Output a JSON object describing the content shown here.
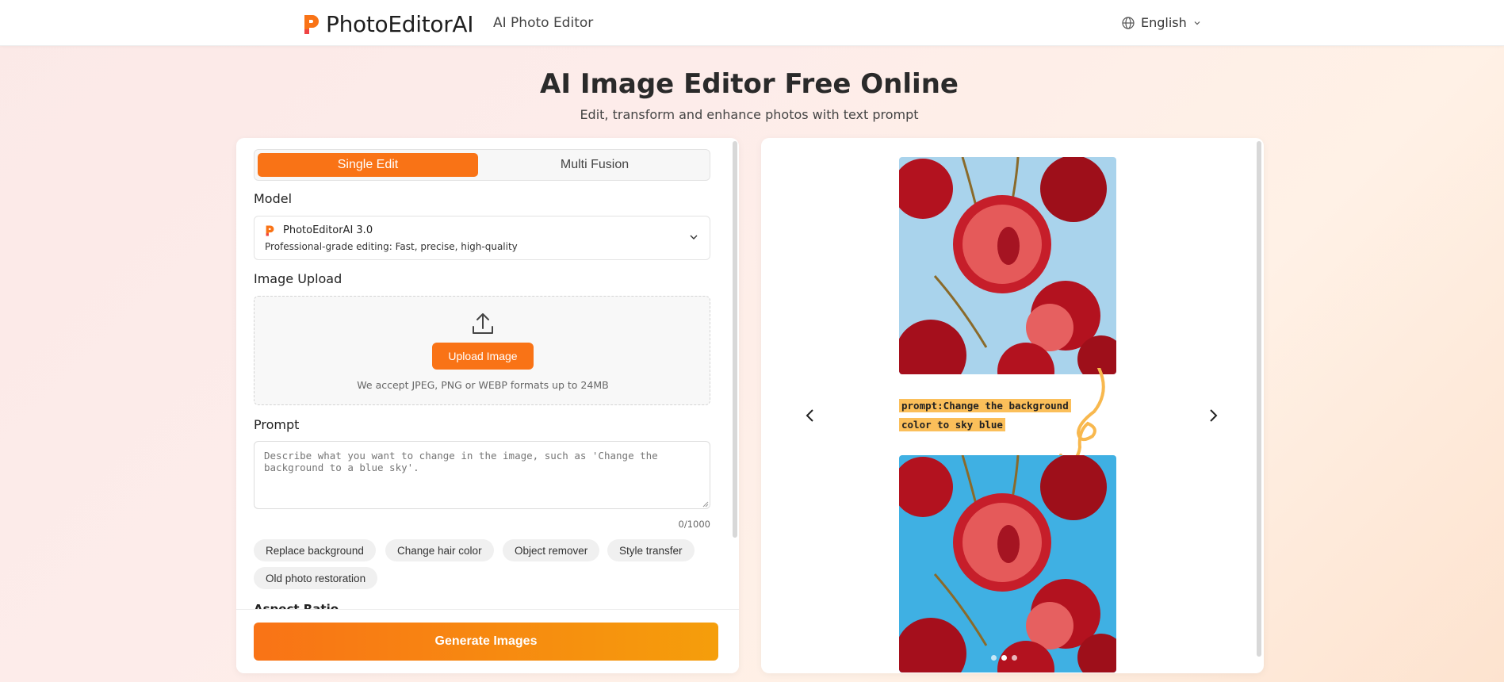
{
  "header": {
    "brand": "PhotoEditorAI",
    "nav_link": "AI Photo Editor",
    "language": "English"
  },
  "hero": {
    "title": "AI Image Editor Free Online",
    "subtitle": "Edit, transform and enhance photos with text prompt"
  },
  "editor": {
    "tabs": [
      {
        "label": "Single Edit",
        "active": true
      },
      {
        "label": "Multi Fusion",
        "active": false
      }
    ],
    "model_label": "Model",
    "model": {
      "name": "PhotoEditorAI 3.0",
      "description": "Professional-grade editing: Fast, precise, high-quality"
    },
    "upload_label": "Image Upload",
    "upload_button": "Upload Image",
    "upload_note": "We accept JPEG, PNG or WEBP formats up to 24MB",
    "prompt_label": "Prompt",
    "prompt_placeholder": "Describe what you want to change in the image, such as 'Change the background to a blue sky'.",
    "prompt_counter": "0/1000",
    "chips": [
      "Replace background",
      "Change hair color",
      "Object remover",
      "Style transfer",
      "Old photo restoration"
    ],
    "aspect_ratio_label": "Aspect Ratio",
    "generate_button": "Generate Images"
  },
  "preview": {
    "caption_line1": "prompt:Change the background",
    "caption_line2": "color to sky blue",
    "slide_count": 3,
    "active_slide": 1
  },
  "colors": {
    "accent": "#f97316",
    "accent_end": "#f59e0b",
    "before_bg": "#a9d3ec",
    "after_bg": "#3fb0e3",
    "cherry": "#b3121f"
  }
}
